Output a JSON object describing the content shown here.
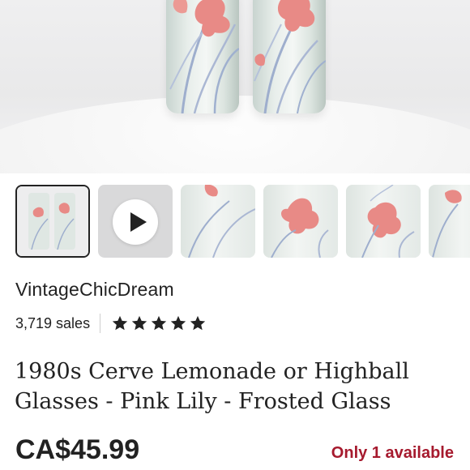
{
  "listing": {
    "shop_name": "VintageChicDream",
    "sales_count": "3,719 sales",
    "rating_stars": 5,
    "title": "1980s Cerve Lemonade or Highball Glasses - Pink Lily - Frosted Glass",
    "price": "CA$45.99",
    "availability": "Only 1 available"
  },
  "colors": {
    "availability": "#a61a2e",
    "flower_pink": "#e88a86",
    "text": "#222222"
  },
  "icons": {
    "play": "play-icon",
    "star": "star-icon"
  }
}
